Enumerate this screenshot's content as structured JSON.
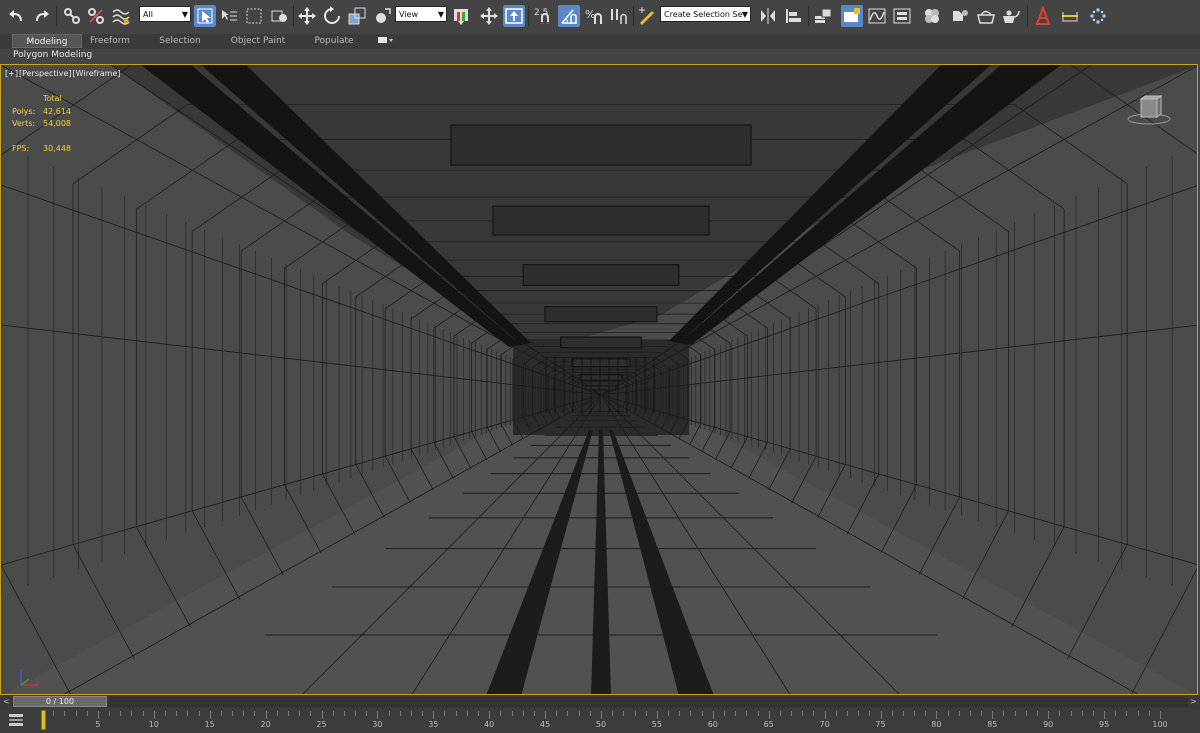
{
  "toolbar": {
    "selection_filter": "All",
    "reference_coord": "View",
    "named_selection_placeholder": "Create Selection Se",
    "snap_angle_label": "2.5",
    "icons": [
      "undo-icon",
      "redo-icon",
      "link-icon",
      "unlink-icon",
      "bind-spacewarp-icon",
      "select-object-icon",
      "select-by-name-icon",
      "rect-selection-icon",
      "window-crossing-icon",
      "move-icon",
      "rotate-icon",
      "scale-icon",
      "placement-icon",
      "pivot-center-icon",
      "select-manipulate-icon",
      "keyboard-shortcut-icon",
      "snaps-toggle-icon",
      "angle-snap-icon",
      "percent-snap-icon",
      "spinner-snap-icon",
      "edit-named-selection-icon",
      "mirror-icon",
      "align-icon",
      "scene-explorer-icon",
      "layer-explorer-icon",
      "curve-editor-icon",
      "schematic-view-icon",
      "material-editor-icon",
      "render-setup-icon",
      "rendered-frame-icon",
      "render-icon",
      "render-iterative-icon",
      "civil-view-icon",
      "measure-icon",
      "particle-view-icon"
    ]
  },
  "ribbon": {
    "tabs": [
      {
        "label": "Modeling",
        "active": true
      },
      {
        "label": "Freeform",
        "active": false
      },
      {
        "label": "Selection",
        "active": false
      },
      {
        "label": "Object Paint",
        "active": false
      },
      {
        "label": "Populate",
        "active": false
      }
    ],
    "sub_label": "Polygon Modeling"
  },
  "viewport": {
    "labels": [
      "[+]",
      "[Perspective]",
      "[Wireframe]"
    ],
    "stats": {
      "header": "Total",
      "polys_label": "Polys:",
      "polys_value": "42,614",
      "verts_label": "Verts:",
      "verts_value": "54,008",
      "fps_label": "FPS:",
      "fps_value": "30,448"
    },
    "border_color": "#c9a326",
    "stats_color": "#f2d233"
  },
  "timeslider": {
    "label": "0 / 100",
    "prev_arrow": "<",
    "next_arrow": ">"
  },
  "trackbar": {
    "tick_labels": [
      "5",
      "10",
      "15",
      "20",
      "25",
      "30",
      "35",
      "40",
      "45",
      "50",
      "55",
      "60",
      "65",
      "70",
      "75",
      "80",
      "85",
      "90",
      "95",
      "100"
    ]
  }
}
